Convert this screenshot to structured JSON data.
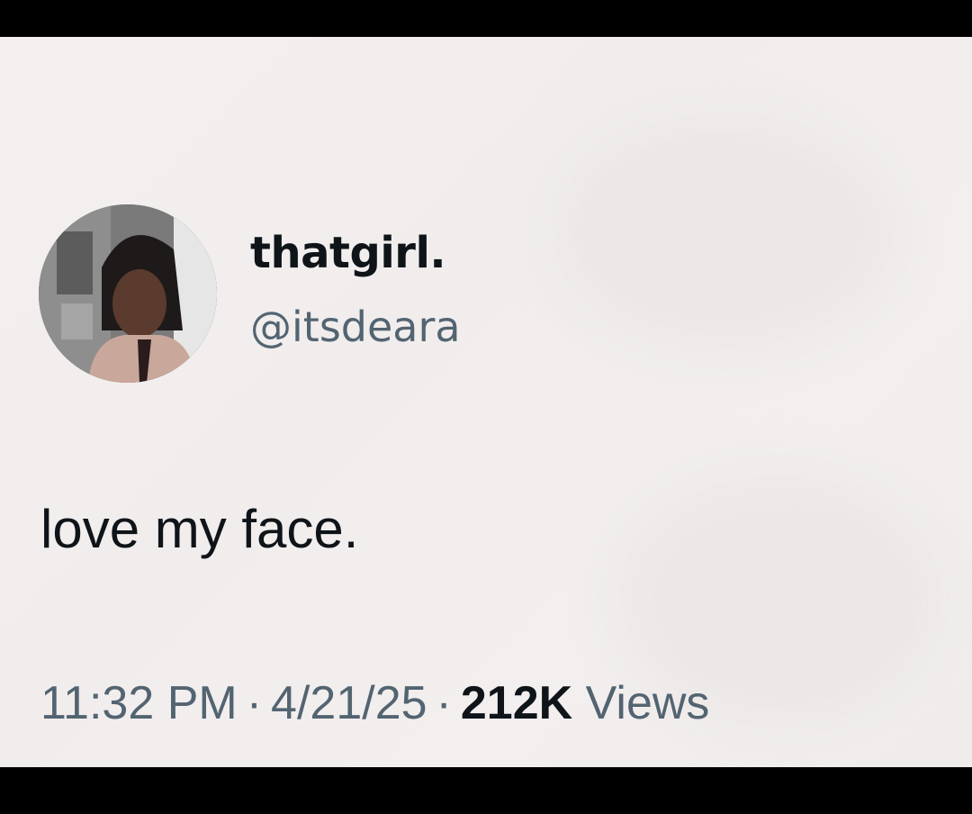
{
  "tweet": {
    "author": {
      "display_name": "thatgirl.",
      "handle": "@itsdeara",
      "avatar_icon": "profile-photo"
    },
    "text": "love my face.",
    "meta": {
      "time": "11:32 PM",
      "date": "4/21/25",
      "separator": "·",
      "views_count": "212K",
      "views_label": "Views"
    }
  },
  "colors": {
    "background": "#f2eeee",
    "primary_text": "#0f1419",
    "secondary_text": "#536471",
    "letterbox": "#000000"
  }
}
